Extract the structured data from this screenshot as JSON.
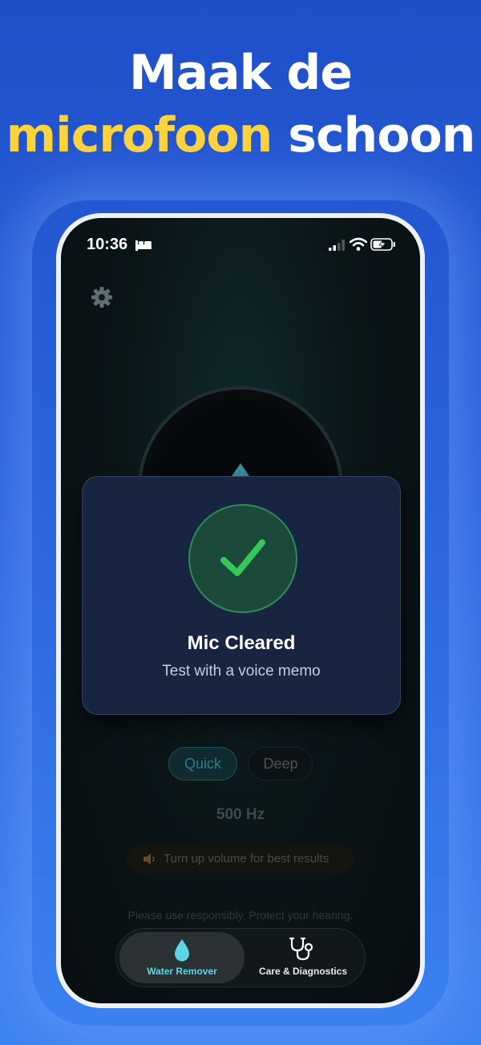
{
  "headline": {
    "line1": "Maak de",
    "highlight": "microfoon",
    "rest": "schoon"
  },
  "status_bar": {
    "time": "10:36",
    "icons": [
      "bed-icon",
      "signal-icon",
      "wifi-icon",
      "battery-charging-icon"
    ]
  },
  "settings": {
    "icon": "gear-icon"
  },
  "dialog": {
    "title": "Mic Cleared",
    "subtitle": "Test with a voice memo",
    "icon": "checkmark-icon"
  },
  "modes": {
    "quick_label": "Quick",
    "deep_label": "Deep",
    "selected": "Quick"
  },
  "frequency": {
    "label": "500 Hz"
  },
  "volume_hint": {
    "text": "Turn up volume for best results",
    "icon": "speaker-icon"
  },
  "disclaimer": "Please use responsibly. Protect your hearing.",
  "tabbar": {
    "tabs": [
      {
        "label": "Water Remover",
        "icon": "water-drop-icon",
        "active": true
      },
      {
        "label": "Care & Diagnostics",
        "icon": "stethoscope-icon",
        "active": false
      }
    ]
  },
  "colors": {
    "background": "#2a62de",
    "highlight": "#ffd43b",
    "accent": "#5fd6e6",
    "success": "#34c759"
  }
}
